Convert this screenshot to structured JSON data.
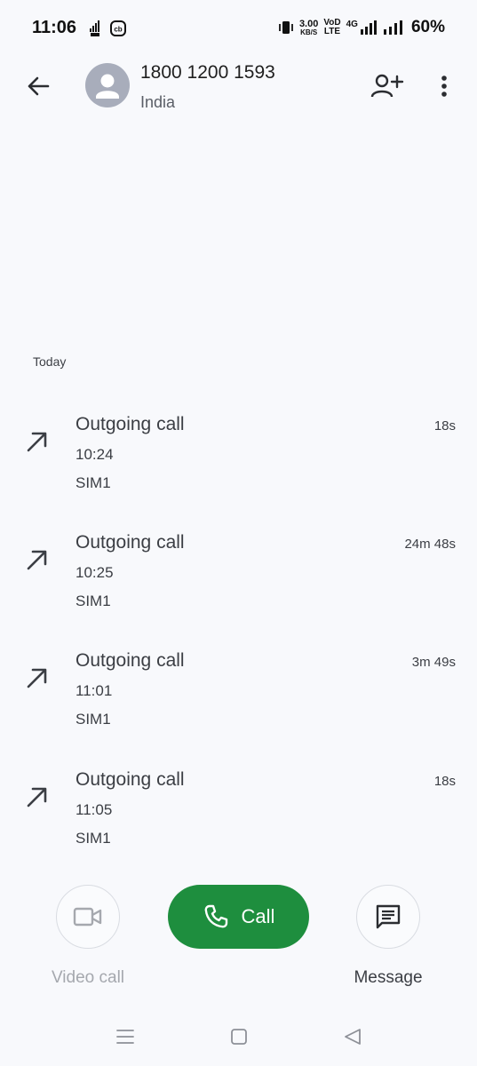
{
  "status_bar": {
    "time": "11:06",
    "data_speed_value": "3.00",
    "data_speed_unit": "KB/S",
    "vo_label": "VoD",
    "lte_label": "LTE",
    "network_label": "4G",
    "battery": "60%"
  },
  "header": {
    "number": "1800 1200 1593",
    "country": "India"
  },
  "section": {
    "label": "Today"
  },
  "calls": [
    {
      "type": "Outgoing call",
      "time": "10:24",
      "sim": "SIM1",
      "duration": "18s"
    },
    {
      "type": "Outgoing call",
      "time": "10:25",
      "sim": "SIM1",
      "duration": "24m 48s"
    },
    {
      "type": "Outgoing call",
      "time": "11:01",
      "sim": "SIM1",
      "duration": "3m 49s"
    },
    {
      "type": "Outgoing call",
      "time": "11:05",
      "sim": "SIM1",
      "duration": "18s"
    }
  ],
  "actions": {
    "video_label": "Video call",
    "call_label": "Call",
    "message_label": "Message"
  },
  "colors": {
    "call_green": "#1e8e3e",
    "background": "#f8f9fc"
  }
}
